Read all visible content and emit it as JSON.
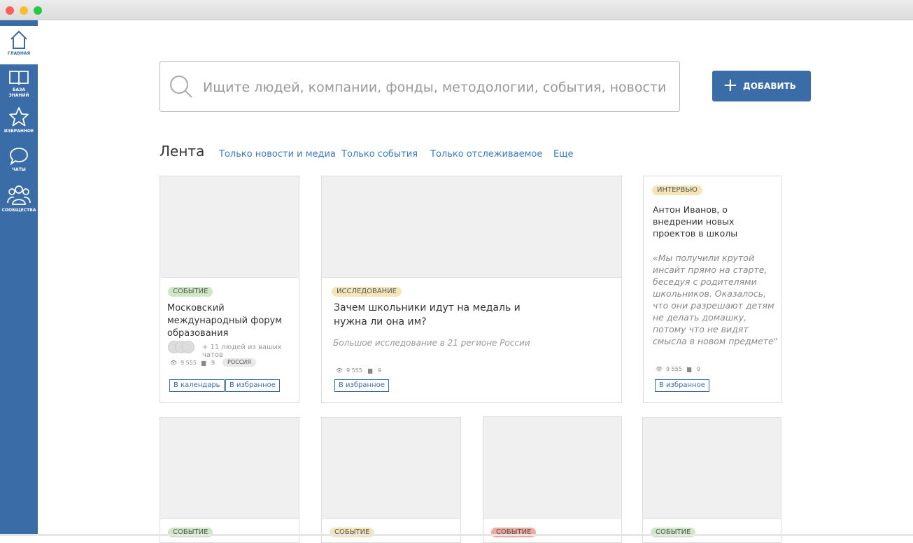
{
  "sidebar": {
    "items": [
      {
        "label": "ГЛАВНАЯ",
        "icon": "home-icon"
      },
      {
        "label": "БАЗА ЗНАНИЙ",
        "icon": "book-icon"
      },
      {
        "label": "ИЗБРАННОЕ",
        "icon": "star-icon"
      },
      {
        "label": "ЧАТЫ",
        "icon": "chat-icon"
      },
      {
        "label": "СООБЩЕСТВА",
        "icon": "people-icon"
      }
    ]
  },
  "search": {
    "placeholder": "Ищите людей, компании, фонды, методологии, события, новости"
  },
  "add_button": "ДОБАВИТЬ",
  "feed": {
    "title": "Лента",
    "filters": [
      "Только новости и медиа",
      "Только события",
      "Только отслеживаемое",
      "Еще"
    ]
  },
  "cards": [
    {
      "tag": "СОБЫТИЕ",
      "title": "Московский международный форум образования",
      "people": "+ 11 людей из ваших чатов",
      "views": "9 555",
      "comments": "9",
      "region": "РОССИЯ",
      "buttons": [
        "В календарь",
        "В избранное"
      ]
    },
    {
      "tag": "ИССЛЕДОВАНИЕ",
      "title": "Зачем школьники идут на медаль и нужна ли она им?",
      "subtitle": "Большое исследование в 21 регионе России",
      "views": "9 555",
      "comments": "9",
      "buttons": [
        "В избранное"
      ]
    },
    {
      "tag": "ИНТЕРВЬЮ",
      "title": "Антон Иванов, о внедрении новых проектов в школы",
      "quote": "«Мы получили крутой инсайт прямо на старте, беседуя с родителями школьников. Оказалось, что они разрешают детям не делать домашку, потому что не видят смысла в новом предмете\"",
      "views": "9 555",
      "comments": "9",
      "buttons": [
        "В избранное"
      ]
    }
  ],
  "row2_tags": [
    "СОБЫТИЕ",
    "СОБЫТИЕ",
    "СОБЫТИЕ",
    "СОБЫТИЕ"
  ],
  "colors": {
    "brand": "#3a6ca8",
    "green": "#cfe8c4",
    "yellow": "#f5e6b8",
    "red": "#eeaa9c"
  }
}
